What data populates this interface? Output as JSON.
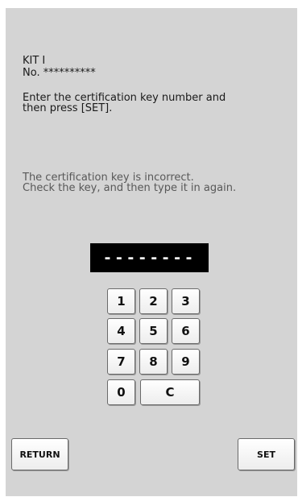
{
  "info": {
    "kit_label": "KIT I",
    "serial_label": "No. **********",
    "instruction": "Enter the certification key number and\nthen press [SET].",
    "error_message": "The certification key is incorrect.\nCheck the key, and then type it in again."
  },
  "key_input": {
    "display": "--------"
  },
  "keypad": {
    "keys": [
      "1",
      "2",
      "3",
      "4",
      "5",
      "6",
      "7",
      "8",
      "9",
      "0",
      "C"
    ]
  },
  "buttons": {
    "return_label": "RETURN",
    "set_label": "SET"
  }
}
